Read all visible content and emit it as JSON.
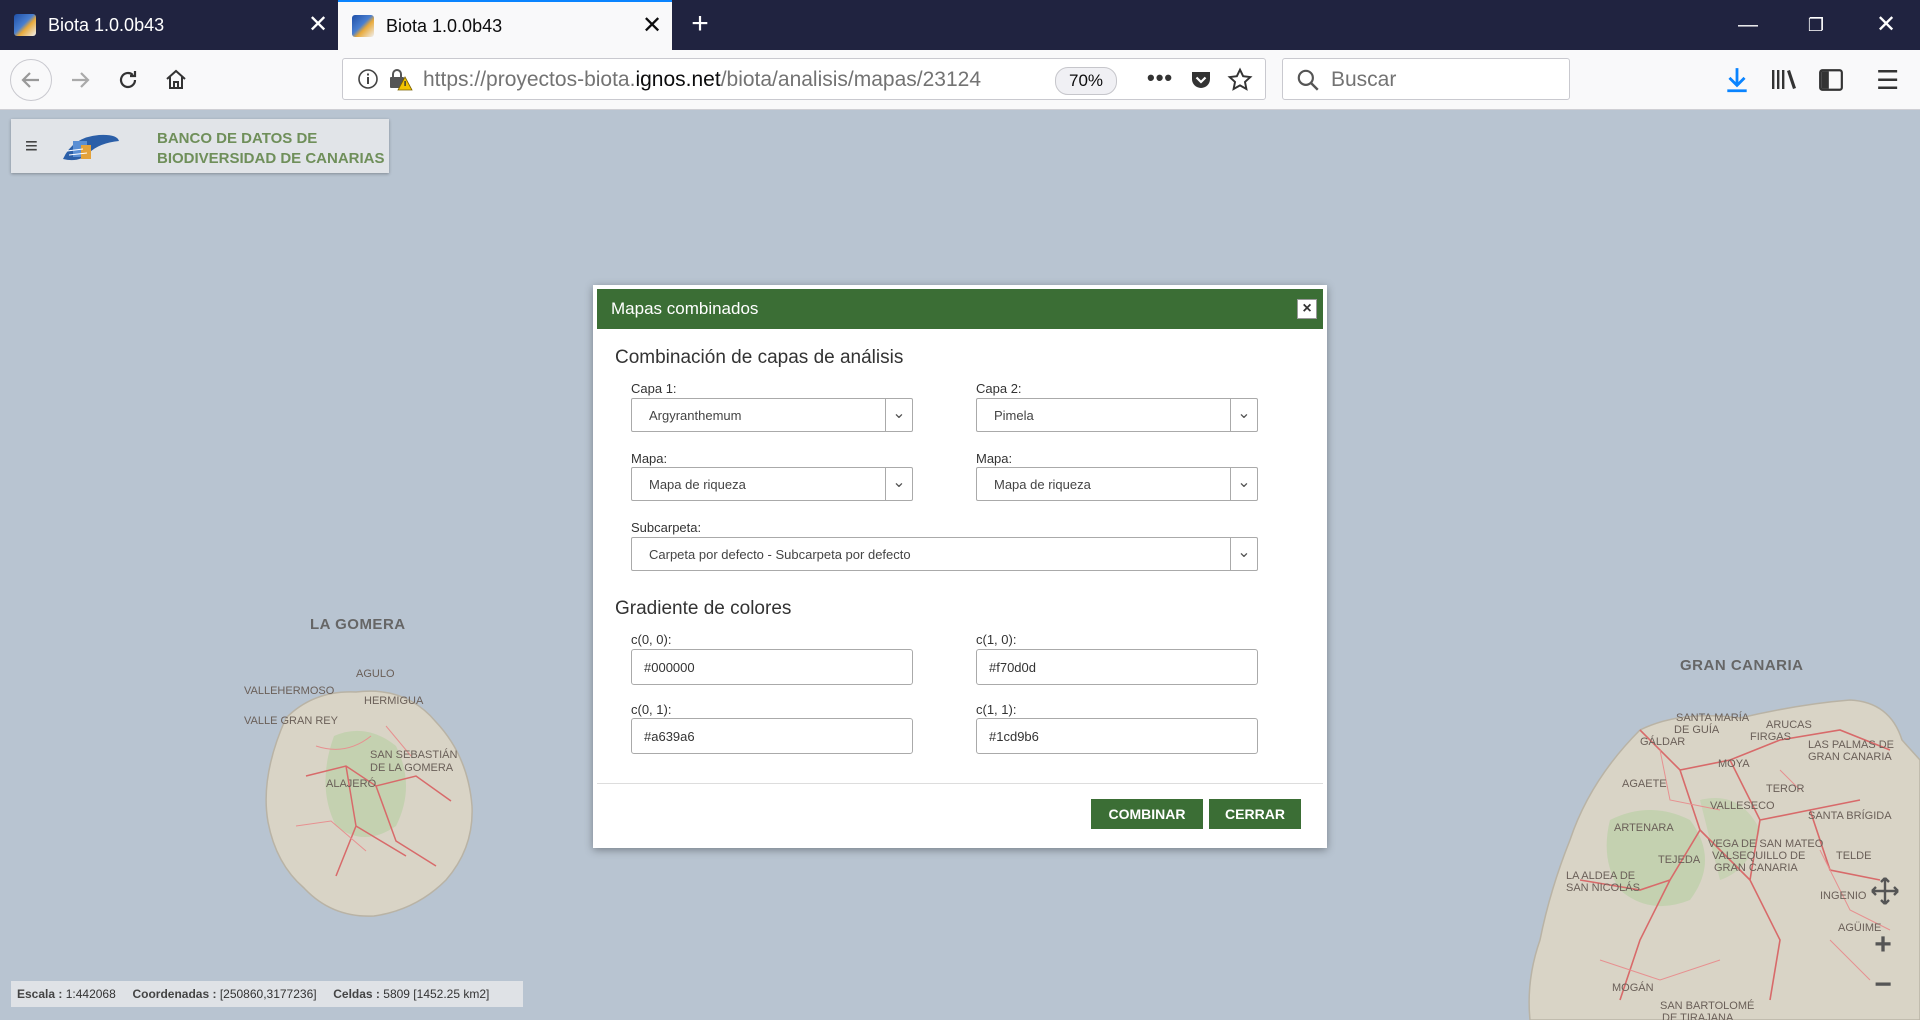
{
  "browser": {
    "tabs": [
      {
        "title": "Biota 1.0.0b43",
        "active": false
      },
      {
        "title": "Biota 1.0.0b43",
        "active": true
      }
    ],
    "url_pre": "https://proyectos-biota.",
    "url_domain": "ignos.net",
    "url_post": "/biota/analisis/mapas/23124",
    "zoom": "70%",
    "search_placeholder": "Buscar"
  },
  "app": {
    "title_line1": "BANCO DE DATOS DE",
    "title_line2": "BIODIVERSIDAD DE CANARIAS"
  },
  "map": {
    "islands": [
      {
        "name": "LA GOMERA"
      },
      {
        "name": "GRAN CANARIA"
      }
    ],
    "gomera_places": [
      "AGULO",
      "VALLEHERMOSO",
      "HERMIGUA",
      "VALLE GRAN REY",
      "SAN SEBASTIÁN",
      "DE LA GOMERA",
      "ALAJERÓ"
    ],
    "gc_places": [
      "SANTA MARÍA",
      "DE GUÍA",
      "GÁLDAR",
      "ARUCAS",
      "FIRGAS",
      "LAS PALMAS DE",
      "GRAN CANARIA",
      "MOYA",
      "AGAETE",
      "TEROR",
      "VALLESECO",
      "SANTA BRÍGIDA",
      "ARTENARA",
      "VEGA DE SAN MATEO",
      "VALSEQUILLO DE",
      "GRAN CANARIA",
      "TEJEDA",
      "TELDE",
      "LA ALDEA DE",
      "SAN NICOLÁS",
      "INGENIO",
      "AGÜIME",
      "MOGÁN",
      "SAN BARTOLOMÉ",
      "DE TIRAJANA"
    ]
  },
  "dialog": {
    "title": "Mapas combinados",
    "section1": "Combinación de capas de análisis",
    "capa1_label": "Capa 1:",
    "capa1_value": "Argyranthemum",
    "capa2_label": "Capa 2:",
    "capa2_value": "Pimela",
    "mapa1_label": "Mapa:",
    "mapa1_value": "Mapa de riqueza",
    "mapa2_label": "Mapa:",
    "mapa2_value": "Mapa de riqueza",
    "subcarpeta_label": "Subcarpeta:",
    "subcarpeta_value": "Carpeta por defecto - Subcarpeta por defecto",
    "section2": "Gradiente de colores",
    "c00_label": "c(0, 0):",
    "c00_value": "#000000",
    "c10_label": "c(1, 0):",
    "c10_value": "#f70d0d",
    "c01_label": "c(0, 1):",
    "c01_value": "#a639a6",
    "c11_label": "c(1, 1):",
    "c11_value": "#1cd9b6",
    "combinar_label": "COMBINAR",
    "cerrar_label": "CERRAR"
  },
  "status": {
    "escala_label": "Escala :",
    "escala_value": "1:442068",
    "coord_label": "Coordenadas :",
    "coord_value": "[250860,3177236]",
    "celdas_label": "Celdas :",
    "celdas_value": "5809 [1452.25 km2]"
  },
  "colors": {
    "accent": "#3b6e35",
    "tabstrip": "#202340",
    "sea": "#b8c4d1",
    "download": "#0a84ff"
  },
  "icons": [
    "back-icon",
    "forward-icon",
    "reload-icon",
    "home-icon",
    "info-icon",
    "lock-warning-icon",
    "more-icon",
    "pocket-icon",
    "star-icon",
    "search-icon",
    "download-icon",
    "library-icon",
    "sidebar-icon",
    "menu-icon",
    "pan-icon",
    "zoom-in-icon",
    "zoom-out-icon"
  ]
}
